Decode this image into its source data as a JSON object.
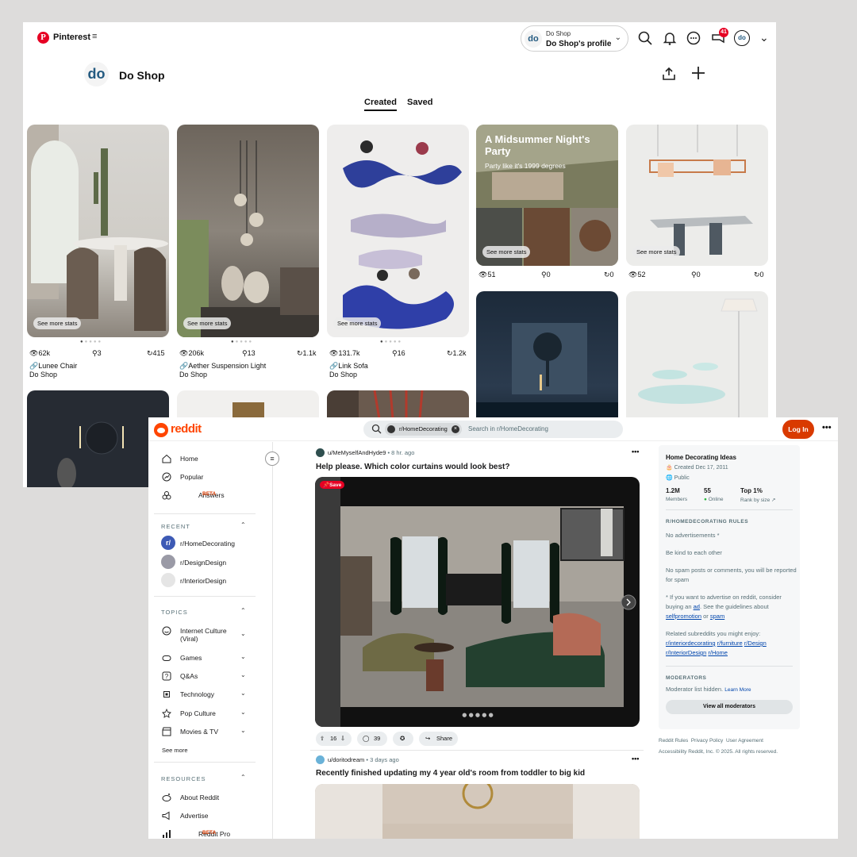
{
  "pinterest": {
    "brand": "Pinterest",
    "menu_glyph": "≡",
    "account_switch": {
      "avatar_text": "do",
      "line1": "Do Shop",
      "line2": "Do Shop's profile"
    },
    "notifications_badge": "41",
    "me_avatar_text": "do",
    "profile": {
      "avatar_text": "do",
      "name": "Do Shop"
    },
    "tabs": {
      "created": "Created",
      "saved": "Saved"
    },
    "see_more_stats": "See more stats",
    "pins": [
      {
        "views": "62k",
        "saves": "3",
        "clicks": "415",
        "title": "Lunee Chair",
        "owner": "Do Shop"
      },
      {
        "views": "206k",
        "saves": "13",
        "clicks": "1.1k",
        "title": "Aether Suspension Light",
        "owner": "Do Shop"
      },
      {
        "views": "131.7k",
        "saves": "16",
        "clicks": "1.2k",
        "title": "Link Sofa",
        "owner": "Do Shop"
      },
      {
        "views": "51",
        "saves": "0",
        "clicks": "0",
        "overlay_title": "A Midsummer Night's Party",
        "overlay_sub": "Party like it's 1999 degrees"
      },
      {
        "views": "52",
        "saves": "0",
        "clicks": "0"
      }
    ]
  },
  "reddit": {
    "brand": "reddit",
    "search": {
      "chip": "r/HomeDecorating",
      "placeholder": "Search in r/HomeDecorating"
    },
    "login": "Log In",
    "more": "•••",
    "nav": [
      {
        "label": "Home",
        "icon": "home-icon"
      },
      {
        "label": "Popular",
        "icon": "popular-icon"
      },
      {
        "label": "Answers",
        "icon": "answers-icon",
        "badge": "BETA"
      }
    ],
    "recent": {
      "heading": "RECENT",
      "items": [
        "r/HomeDecorating",
        "r/DesignDesign",
        "r/InteriorDesign"
      ]
    },
    "topics": {
      "heading": "TOPICS",
      "items": [
        {
          "label": "Internet Culture",
          "label2": "(Viral)"
        },
        {
          "label": "Games"
        },
        {
          "label": "Q&As"
        },
        {
          "label": "Technology"
        },
        {
          "label": "Pop Culture"
        },
        {
          "label": "Movies & TV"
        }
      ],
      "see_more": "See more"
    },
    "resources": {
      "heading": "RESOURCES",
      "items": [
        {
          "label": "About Reddit"
        },
        {
          "label": "Advertise"
        },
        {
          "label": "Reddit Pro",
          "badge": "BETA"
        }
      ]
    },
    "post1": {
      "user": "u/MeMyselfAndHyde9",
      "time": "• 8 hr. ago",
      "title": "Help please. Which color curtains would look best?",
      "save": "Save",
      "votes": "16",
      "comments": "39",
      "share": "Share"
    },
    "post2": {
      "user": "u/doritodream",
      "time": "• 3 days ago",
      "title": "Recently finished updating my 4 year old's room from toddler to big kid"
    },
    "sidebar": {
      "title": "Home Decorating Ideas",
      "created": "Created Dec 17, 2011",
      "visibility": "Public",
      "members_value": "1.2M",
      "members_label": "Members",
      "online_value": "55",
      "online_label": "Online",
      "rank_value": "Top 1%",
      "rank_label": "Rank by size",
      "rules_heading": "R/HOMEDECORATING RULES",
      "rule1": "No advertisements *",
      "rule2": "Be kind to each other",
      "rule3": "No spam posts or comments, you will be reported for spam",
      "rule4_a": "* If you want to advertise on reddit, consider buying an ",
      "rule4_link1": "ad",
      "rule4_b": ". See the guidelines about ",
      "rule4_link2": "selfpromotion",
      "rule4_c": " or ",
      "rule4_link3": "spam",
      "related_text": "Related subreddits you might enjoy:",
      "related": [
        "r/interiordecorating",
        "r/furniture",
        "r/Design",
        "r/InteriorDesign",
        "r/Home"
      ],
      "mods_heading": "MODERATORS",
      "mods_text": "Moderator list hidden.",
      "mods_link": "Learn More",
      "view_mods": "View all moderators"
    },
    "footer": {
      "links": [
        "Reddit Rules",
        "Privacy Policy",
        "User Agreement"
      ],
      "line2": "Accessibility  Reddit, Inc. © 2025. All rights reserved."
    }
  }
}
